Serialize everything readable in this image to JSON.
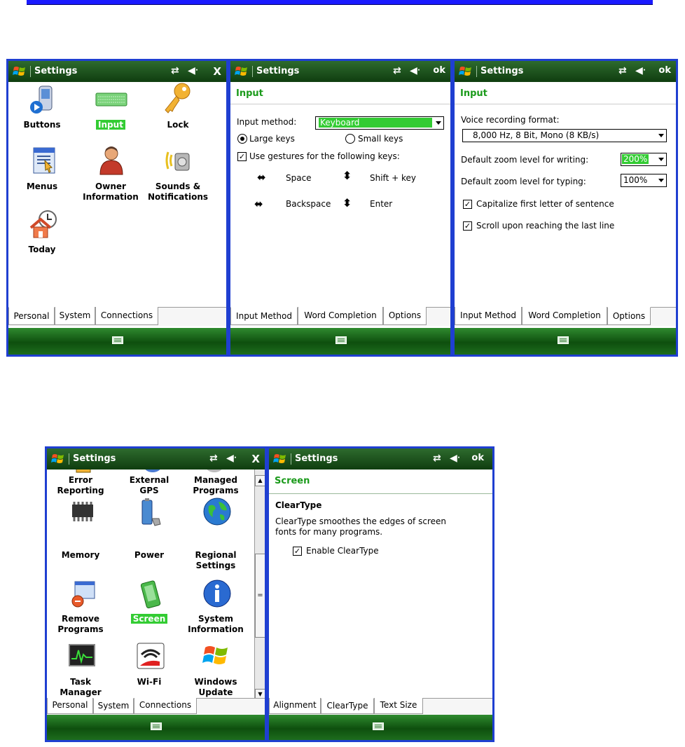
{
  "screens": {
    "s1": {
      "title": "Settings",
      "close": "X",
      "icons": {
        "buttons": "Buttons",
        "input": "Input",
        "lock": "Lock",
        "menus": "Menus",
        "owner_1": "Owner",
        "owner_2": "Information",
        "sounds_1": "Sounds &",
        "sounds_2": "Notifications",
        "today": "Today"
      },
      "tabs": [
        "Personal",
        "System",
        "Connections"
      ]
    },
    "s2": {
      "title": "Settings",
      "ok": "ok",
      "header": "Input",
      "input_method_label": "Input method:",
      "input_method_value": "Keyboard",
      "large_keys": "Large keys",
      "small_keys": "Small keys",
      "gestures_label": "Use gestures for the following keys:",
      "gesture_space": "Space",
      "gesture_shift": "Shift + key",
      "gesture_backspace": "Backspace",
      "gesture_enter": "Enter",
      "tabs": [
        "Input Method",
        "Word Completion",
        "Options"
      ]
    },
    "s3": {
      "title": "Settings",
      "ok": "ok",
      "header": "Input",
      "voice_label": "Voice recording format:",
      "voice_value": "8,000 Hz, 8 Bit, Mono (8 KB/s)",
      "zoom_writing_label": "Default zoom level for writing:",
      "zoom_writing_value": "200%",
      "zoom_typing_label": "Default zoom level for typing:",
      "zoom_typing_value": "100%",
      "capitalize": "Capitalize first letter of sentence",
      "scroll": "Scroll upon reaching the last line",
      "tabs": [
        "Input Method",
        "Word Completion",
        "Options"
      ]
    },
    "s4": {
      "title": "Settings",
      "close": "X",
      "icons": {
        "error_1": "Error",
        "error_2": "Reporting",
        "gps_1": "External",
        "gps_2": "GPS",
        "managed_1": "Managed",
        "managed_2": "Programs",
        "memory": "Memory",
        "power": "Power",
        "regional_1": "Regional",
        "regional_2": "Settings",
        "remove_1": "Remove",
        "remove_2": "Programs",
        "screen": "Screen",
        "sysinfo_1": "System",
        "sysinfo_2": "Information",
        "task_1": "Task",
        "task_2": "Manager",
        "wifi": "Wi-Fi",
        "update_1": "Windows",
        "update_2": "Update"
      },
      "tabs": [
        "Personal",
        "System",
        "Connections"
      ]
    },
    "s5": {
      "title": "Settings",
      "ok": "ok",
      "header": "Screen",
      "section": "ClearType",
      "desc_1": "ClearType smoothes the edges of screen",
      "desc_2": "fonts for many programs.",
      "enable": "Enable ClearType",
      "tabs": [
        "Alignment",
        "ClearType",
        "Text Size"
      ]
    }
  },
  "colors": {
    "titlebar": "#1a4d1a",
    "selection": "#33cc33",
    "frame": "#1f3fd1",
    "header_text": "#1a9a1a"
  }
}
